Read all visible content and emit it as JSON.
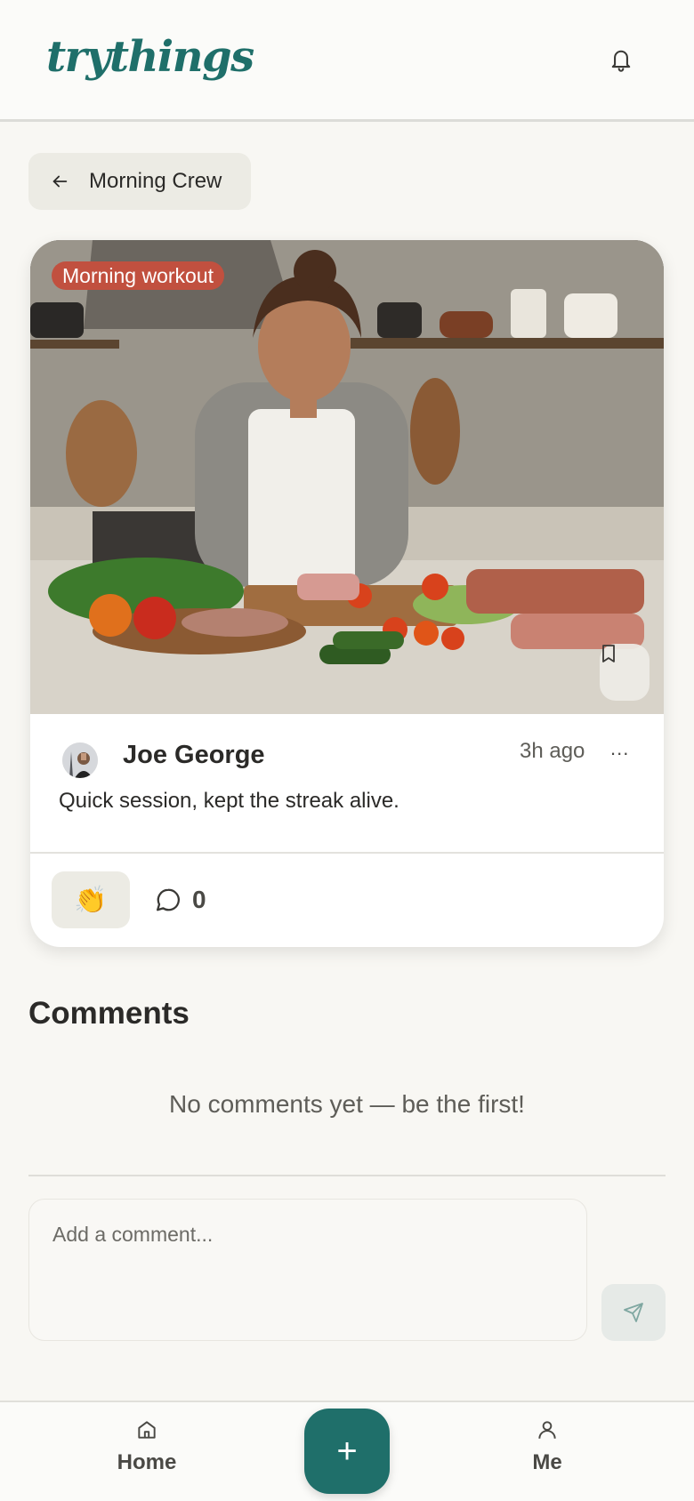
{
  "app": {
    "logo_text": "trythings"
  },
  "back": {
    "label": "Morning Crew"
  },
  "post": {
    "tag": "Morning workout",
    "author": "Joe George",
    "time": "3h ago",
    "more": "...",
    "caption": "Quick session, kept the streak alive.",
    "reaction_emoji": "👏",
    "comment_count": "0"
  },
  "comments": {
    "title": "Comments",
    "empty_text": "No comments yet — be the first!",
    "input_placeholder": "Add a comment..."
  },
  "nav": {
    "home_label": "Home",
    "add_label": "+",
    "me_label": "Me"
  },
  "colors": {
    "brand": "#1f6f6a",
    "tag": "#c1503f",
    "background": "#f8f7f3"
  },
  "icons": [
    "bell-icon",
    "arrow-left-icon",
    "bookmark-icon",
    "more-icon",
    "comment-icon",
    "send-icon",
    "home-icon",
    "plus-icon",
    "user-icon"
  ]
}
